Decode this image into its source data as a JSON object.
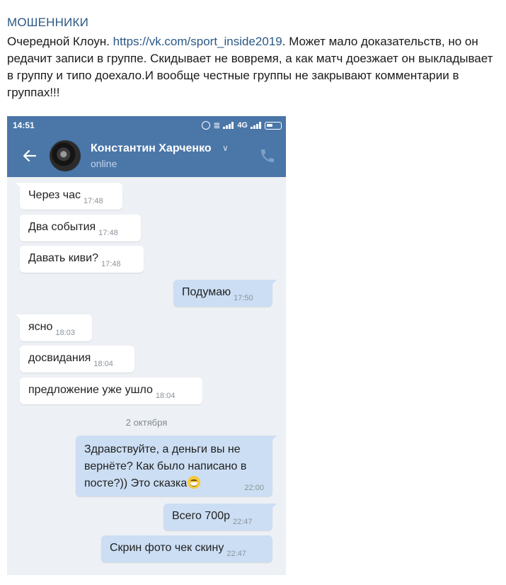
{
  "post": {
    "header": "МОШЕННИКИ",
    "intro": "Очередной Клоун. ",
    "link": "https://vk.com/sport_inside2019",
    "body": ". Может мало доказательств, но он редачит записи в группе. Скидывает не вовремя, а как матч доезжает он выкладывает в группу и типо доехало.И вообще честные группы не закрывают комментарии в группах!!!"
  },
  "phone": {
    "status_time": "14:51",
    "network": "4G",
    "contact_name": "Константин Харченко",
    "contact_status": "online",
    "date_separator": "2 октября",
    "messages": [
      {
        "dir": "in",
        "text": "Через час",
        "time": "17:48"
      },
      {
        "dir": "in",
        "text": "Два события",
        "time": "17:48"
      },
      {
        "dir": "in",
        "text": "Давать киви?",
        "time": "17:48"
      },
      {
        "dir": "out",
        "text": "Подумаю",
        "time": "17:50"
      },
      {
        "dir": "in",
        "text": "ясно",
        "time": "18:03"
      },
      {
        "dir": "in",
        "text": "досвидания",
        "time": "18:04"
      },
      {
        "dir": "in",
        "text": "предложение уже ушло",
        "time": "18:04"
      },
      {
        "dir": "out",
        "text": "Здравствуйте, а деньги вы не\nвернёте? Как было написано в\nпосте?)) Это сказка",
        "time": "22:00",
        "emoji": "smiling-face-icon"
      },
      {
        "dir": "out",
        "text": "Всего 700р",
        "time": "22:47"
      },
      {
        "dir": "out",
        "text": "Скрин фото чек скину",
        "time": "22:47"
      }
    ]
  },
  "colors": {
    "vk_blue": "#4a76a8",
    "chat_bg": "#edf0f4",
    "outgoing_bubble": "#ccdef3",
    "link": "#2a5885"
  }
}
